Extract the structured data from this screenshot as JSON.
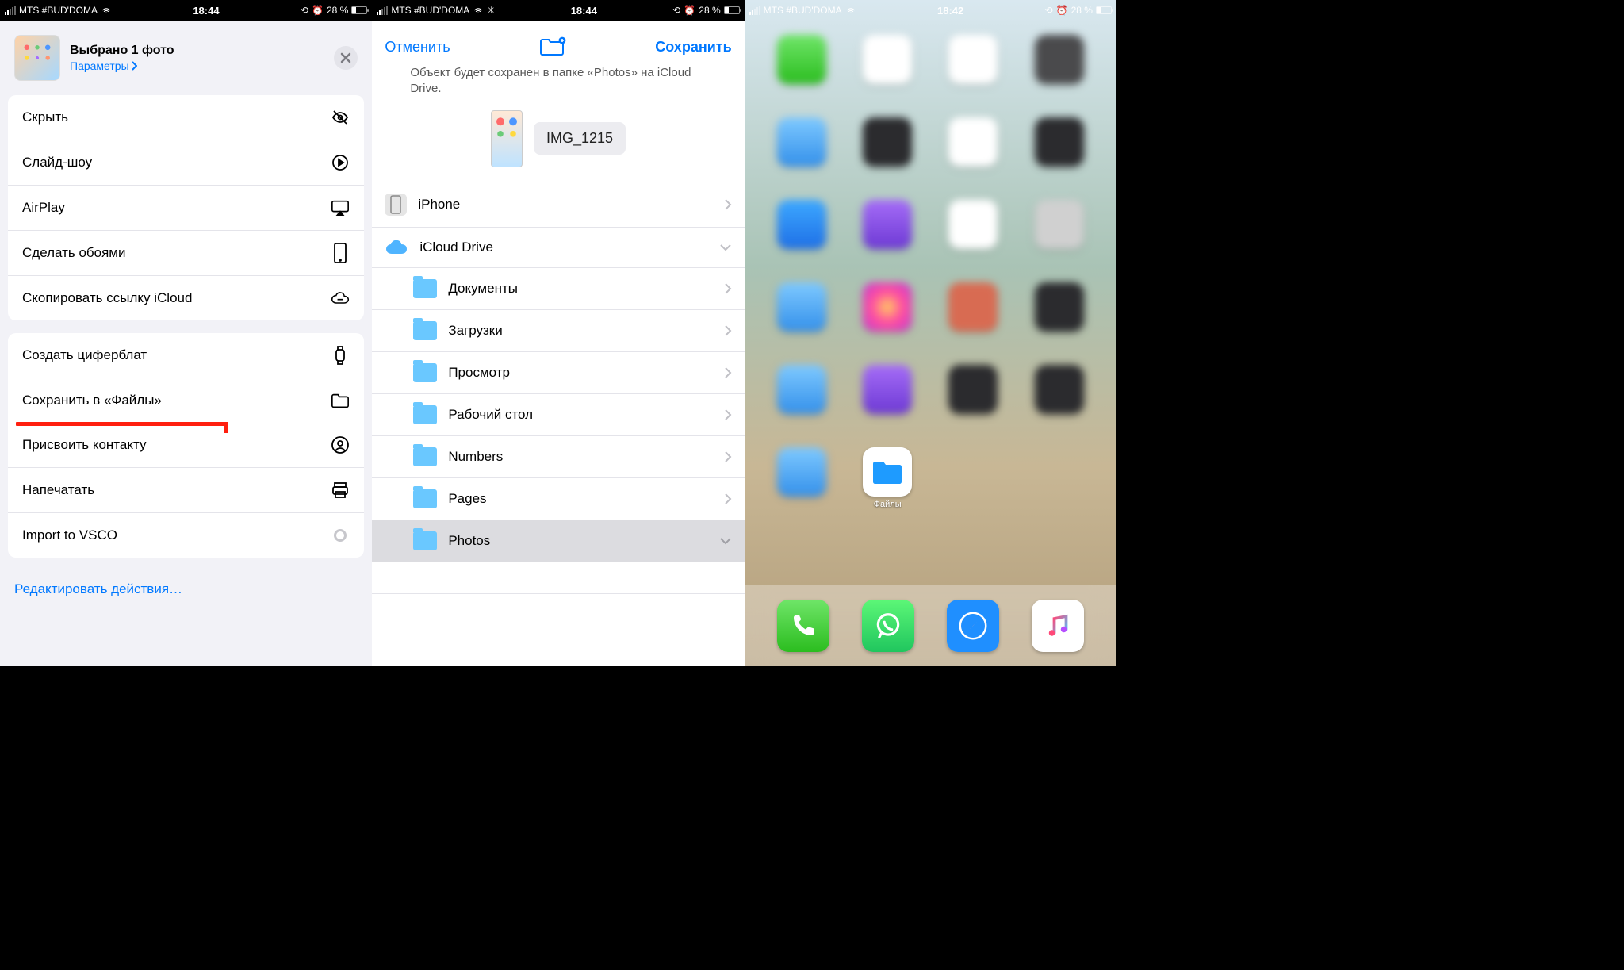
{
  "status": {
    "carrier": "MTS #BUD'DOMA",
    "time1": "18:44",
    "time2": "18:44",
    "time3": "18:42",
    "battery": "28 %"
  },
  "panel1": {
    "title": "Выбрано 1 фото",
    "params": "Параметры",
    "actions_a": [
      {
        "label": "Скрыть",
        "icon": "eye-off"
      },
      {
        "label": "Слайд-шоу",
        "icon": "play"
      },
      {
        "label": "AirPlay",
        "icon": "airplay"
      },
      {
        "label": "Сделать обоями",
        "icon": "phone"
      },
      {
        "label": "Скопировать ссылку iCloud",
        "icon": "link-cloud"
      }
    ],
    "actions_b": [
      {
        "label": "Создать циферблат",
        "icon": "watch"
      },
      {
        "label": "Сохранить в «Файлы»",
        "icon": "folder",
        "hl": true
      },
      {
        "label": "Присвоить контакту",
        "icon": "contact"
      },
      {
        "label": "Напечатать",
        "icon": "print"
      },
      {
        "label": "Import to VSCO",
        "icon": "dot"
      }
    ],
    "edit": "Редактировать действия…"
  },
  "panel2": {
    "cancel": "Отменить",
    "save": "Сохранить",
    "desc": "Объект будет сохранен в папке «Photos» на iCloud Drive.",
    "filename": "IMG_1215",
    "iphone": "iPhone",
    "icloud": "iCloud Drive",
    "folders": [
      {
        "label": "Документы"
      },
      {
        "label": "Загрузки"
      },
      {
        "label": "Просмотр"
      },
      {
        "label": "Рабочий стол"
      },
      {
        "label": "Numbers"
      },
      {
        "label": "Pages"
      },
      {
        "label": "Photos",
        "selected": true
      }
    ]
  },
  "panel3": {
    "files_label": "Файлы"
  }
}
